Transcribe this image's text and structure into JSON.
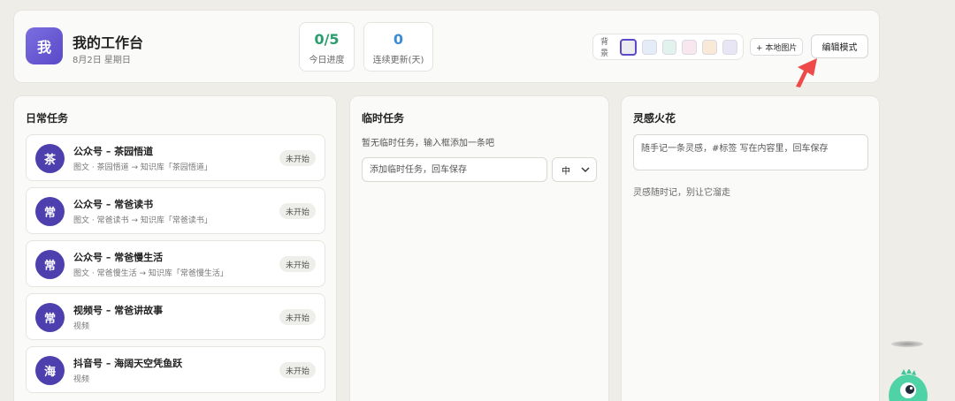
{
  "header": {
    "avatar_char": "我",
    "title": "我的工作台",
    "date": "8月2日 星期日",
    "stats": [
      {
        "value": "0/5",
        "label": "今日进度"
      },
      {
        "value": "0",
        "label": "连续更新(天)"
      }
    ],
    "bg_label": "背景",
    "swatches": [
      "#ececf0",
      "#e4ecf8",
      "#e2f3ee",
      "#f9e7ef",
      "#f8ead6",
      "#e8e6f5"
    ],
    "local_image_label": "+ 本地图片",
    "edit_mode_label": "编辑模式",
    "accent_color": "#5a49c8",
    "arrow_color": "#ef4a4a"
  },
  "daily": {
    "title": "日常任务",
    "tasks": [
      {
        "avatar": "茶",
        "name": "公众号 – 茶园悟道",
        "sub": "图文 · 茶园悟道 → 知识库「茶园悟道」",
        "status": "未开始"
      },
      {
        "avatar": "常",
        "name": "公众号 – 常爸读书",
        "sub": "图文 · 常爸读书 → 知识库「常爸读书」",
        "status": "未开始"
      },
      {
        "avatar": "常",
        "name": "公众号 – 常爸慢生活",
        "sub": "图文 · 常爸慢生活 → 知识库「常爸慢生活」",
        "status": "未开始"
      },
      {
        "avatar": "常",
        "name": "视频号 – 常爸讲故事",
        "sub": "视频",
        "status": "未开始"
      },
      {
        "avatar": "海",
        "name": "抖音号 – 海阔天空凭鱼跃",
        "sub": "视频",
        "status": "未开始"
      }
    ]
  },
  "temp": {
    "title": "临时任务",
    "hint": "暂无临时任务，输入框添加一条吧",
    "input_placeholder": "添加临时任务，回车保存",
    "priority": "中"
  },
  "ideas": {
    "title": "灵感火花",
    "input_placeholder": "随手记一条灵感，#标签 写在内容里，回车保存",
    "hint": "灵感随时记，别让它溜走"
  }
}
